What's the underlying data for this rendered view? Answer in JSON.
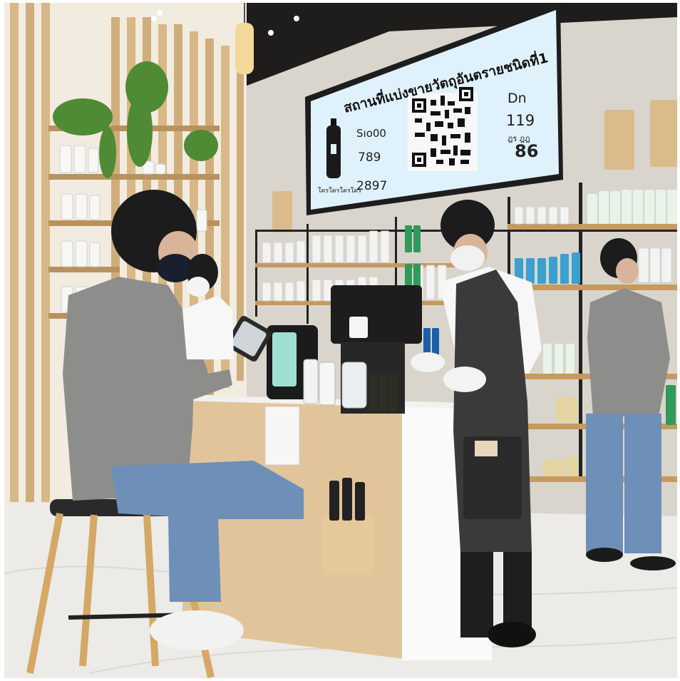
{
  "monitor": {
    "title": "สถานที่แบ่งขายวัตถุอันตรายชนิดที่1",
    "left_label_1": "Sıo00",
    "left_value_1": "789",
    "left_value_2": "2897",
    "left_caption": "ใครใครใครใคร",
    "right_label": "Dn",
    "right_value_1": "119",
    "right_caption": "ฎร ฎฎ",
    "right_value_2": "86"
  },
  "colors": {
    "wall": "#e9e5de",
    "wood_slat": "#d8b887",
    "monitor_screen": "#dff1fa",
    "counter_front": "#e2c49a",
    "bottle_green": "#2f9a5a",
    "shirt_grey": "#8d8d8b",
    "jeans_blue": "#6d8fb8",
    "apron_dark": "#3a3a3a"
  }
}
